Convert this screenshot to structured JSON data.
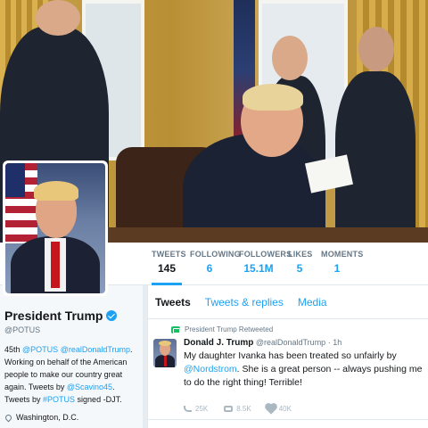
{
  "stats": [
    {
      "label": "TWEETS",
      "value": "145"
    },
    {
      "label": "FOLLOWING",
      "value": "6"
    },
    {
      "label": "FOLLOWERS",
      "value": "15.1M"
    },
    {
      "label": "LIKES",
      "value": "5"
    },
    {
      "label": "MOMENTS",
      "value": "1"
    }
  ],
  "profile": {
    "name": "President Trump",
    "handle": "@POTUS",
    "bio": {
      "p1": "45th ",
      "link1": "@POTUS",
      "p2": " ",
      "link2": "@realDonaldTrump",
      "p3": ". Working on behalf of the American people to make our country great again. Tweets by ",
      "link3": "@Scavino45",
      "p4": ". Tweets by ",
      "link4": "#POTUS",
      "p5": " signed -DJT."
    },
    "location": "Washington, D.C."
  },
  "tabs": [
    "Tweets",
    "Tweets & replies",
    "Media"
  ],
  "tweet": {
    "retweet_label": "President Trump Retweeted",
    "author": "Donald J. Trump",
    "meta": "@realDonaldTrump · 1h",
    "text_before": "My daughter Ivanka has been treated so unfairly by ",
    "mention": "@Nordstrom",
    "text_after": ". She is a great person -- always pushing me to do the right thing! Terrible!",
    "replies": "25K",
    "retweets": "8.5K",
    "likes": "40K"
  },
  "colors": {
    "accent": "#1da1f2",
    "verified": "#1da1f2",
    "retweet": "#17bf63"
  }
}
